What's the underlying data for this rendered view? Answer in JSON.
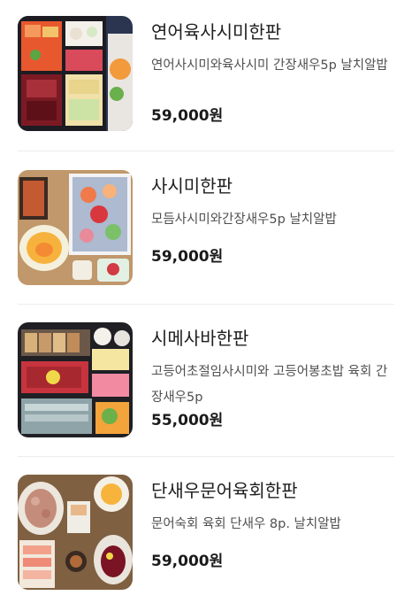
{
  "menu": {
    "items": [
      {
        "name": "연어육사시미한판",
        "description": "연어사시미와육사시미 간장새우5p 날치알밥",
        "price": "59,000원",
        "image_icon": "food-platter-photo"
      },
      {
        "name": "사시미한판",
        "description": "모듬사시미와간장새우5p 날치알밥",
        "price": "59,000원",
        "image_icon": "food-platter-photo"
      },
      {
        "name": "시메사바한판",
        "description": "고등어초절임사시미와 고등어봉초밥 육회 간장새우5p",
        "price": "55,000원",
        "image_icon": "food-platter-photo"
      },
      {
        "name": "단새우문어육회한판",
        "description": "문어숙회 육회 단새우 8p. 날치알밥",
        "price": "59,000원",
        "image_icon": "food-platter-photo"
      }
    ]
  }
}
